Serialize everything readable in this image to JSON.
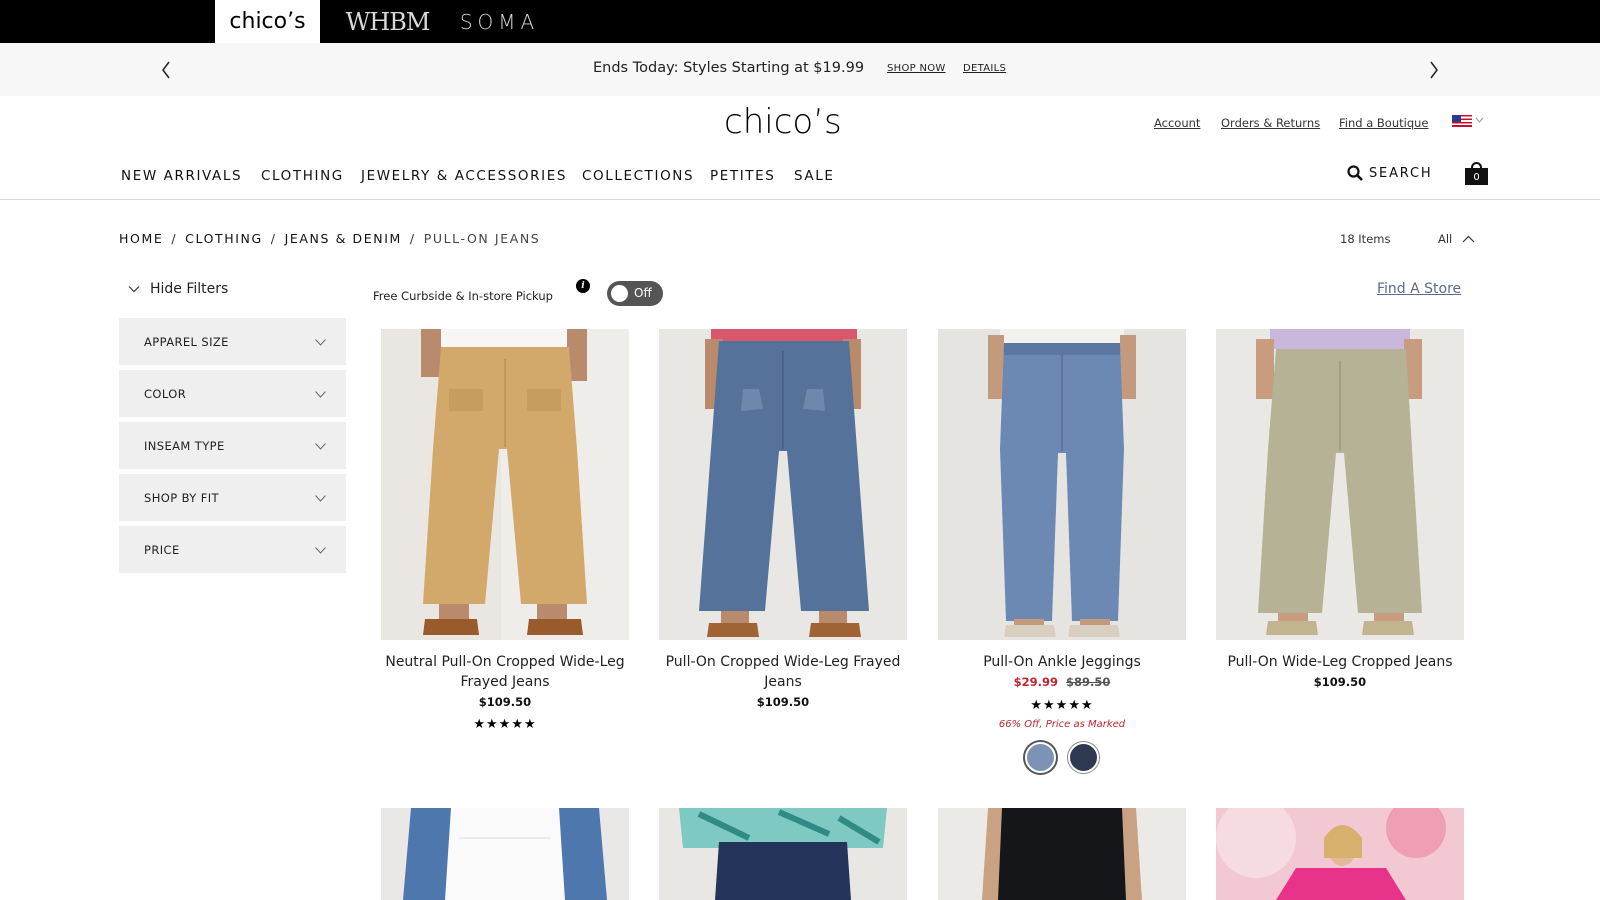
{
  "brands": {
    "chicos": "chico’s",
    "whbm": "WHBM",
    "soma": "SOMA"
  },
  "promo": {
    "text": "Ends Today: Styles Starting at $19.99",
    "shop_now": "SHOP NOW",
    "details": "DETAILS"
  },
  "header": {
    "logo": "chico’s",
    "account": "Account",
    "orders": "Orders & Returns",
    "boutique": "Find a Boutique",
    "search": "SEARCH",
    "bag_count": "0"
  },
  "nav": [
    "NEW ARRIVALS",
    "CLOTHING",
    "JEWELRY & ACCESSORIES",
    "COLLECTIONS",
    "PETITES",
    "SALE"
  ],
  "breadcrumb": {
    "home": "HOME",
    "clothing": "CLOTHING",
    "denim": "JEANS & DENIM",
    "current": "PULL-ON JEANS"
  },
  "results": {
    "count": "18 Items",
    "view": "All"
  },
  "filters": {
    "hide": "Hide Filters",
    "groups": [
      "APPAREL SIZE",
      "COLOR",
      "INSEAM TYPE",
      "SHOP BY FIT",
      "PRICE"
    ]
  },
  "pickup": {
    "label": "Free Curbside & In-store Pickup",
    "info": "i",
    "toggle": "Off",
    "find_store": "Find A Store"
  },
  "products": [
    {
      "name": "Neutral Pull-On Cropped Wide-Leg Frayed Jeans",
      "price": "$109.50",
      "rating": "★★★★★"
    },
    {
      "name": "Pull-On Cropped Wide-Leg Frayed Jeans",
      "price": "$109.50"
    },
    {
      "name": "Pull-On Ankle Jeggings",
      "sale_price": "$29.99",
      "was_price": "$89.50",
      "rating": "★★★★★",
      "promo": "66% Off, Price as Marked",
      "swatches": [
        "#7d93b6",
        "#2e3a52"
      ]
    },
    {
      "name": "Pull-On Wide-Leg Cropped Jeans",
      "price": "$109.50"
    }
  ],
  "colors": {
    "sale": "#c0272d",
    "find_store": "#5a6b8c",
    "filter_bg": "#efefef"
  }
}
